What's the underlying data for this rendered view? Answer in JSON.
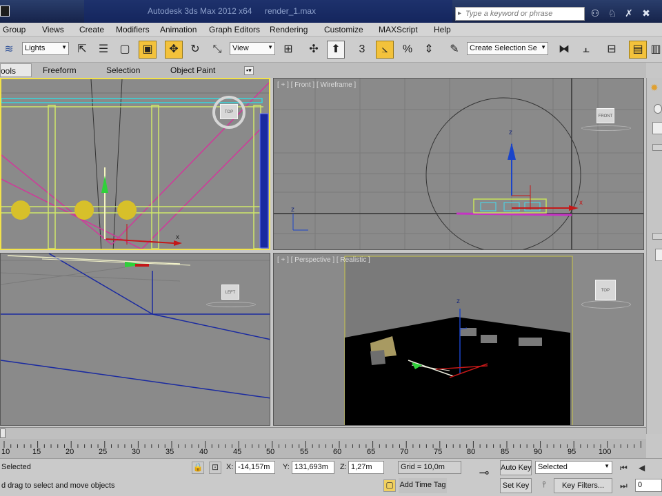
{
  "window": {
    "title": "Autodesk 3ds Max  2012 x64",
    "file": "render_1.max",
    "search_placeholder": "Type a keyword or phrase"
  },
  "menu": [
    "Group",
    "Views",
    "Create",
    "Modifiers",
    "Animation",
    "Graph Editors",
    "Rendering",
    "Customize",
    "MAXScript",
    "Help"
  ],
  "toolbar": {
    "selection_filter": "Lights",
    "reference_coord": "View",
    "three_label": "3",
    "named_selection": "Create Selection Se"
  },
  "ribbon": {
    "tabs": [
      "ools",
      "Freeform",
      "Selection",
      "Object Paint"
    ]
  },
  "viewports": {
    "top": {
      "cube_label": "TOP"
    },
    "front": {
      "label": "[ + ] [ Front ] [ Wireframe ]",
      "cube_label": "FRONT"
    },
    "left": {
      "cube_label": "LEFT"
    },
    "perspective": {
      "label": "[ + ] [ Perspective ] [ Realistic ]",
      "cube_label": "TOP"
    }
  },
  "axis_labels": {
    "x": "x",
    "z": "z"
  },
  "timeline": {
    "ticks": [
      "10",
      "15",
      "20",
      "25",
      "30",
      "35",
      "40",
      "45",
      "50",
      "55",
      "60",
      "65",
      "70",
      "75",
      "80",
      "85",
      "90",
      "95",
      "100"
    ]
  },
  "status": {
    "selection": "Selected",
    "prompt": "d drag to select and move objects",
    "x_label": "X:",
    "x_value": "-14,157m",
    "y_label": "Y:",
    "y_value": "131,693m",
    "z_label": "Z:",
    "z_value": "1,27m",
    "grid": "Grid = 10,0m",
    "add_time_tag": "Add Time Tag",
    "auto_key": "Auto Key",
    "auto_key_value": "Selected",
    "set_key": "Set Key",
    "key_filters": "Key Filters...",
    "frame": "0"
  },
  "colors": {
    "titlebar": "#1f305c",
    "active_button": "#f3c23b",
    "viewport_bg": "#8a8a8a",
    "active_viewport_border": "#f2e24a"
  }
}
